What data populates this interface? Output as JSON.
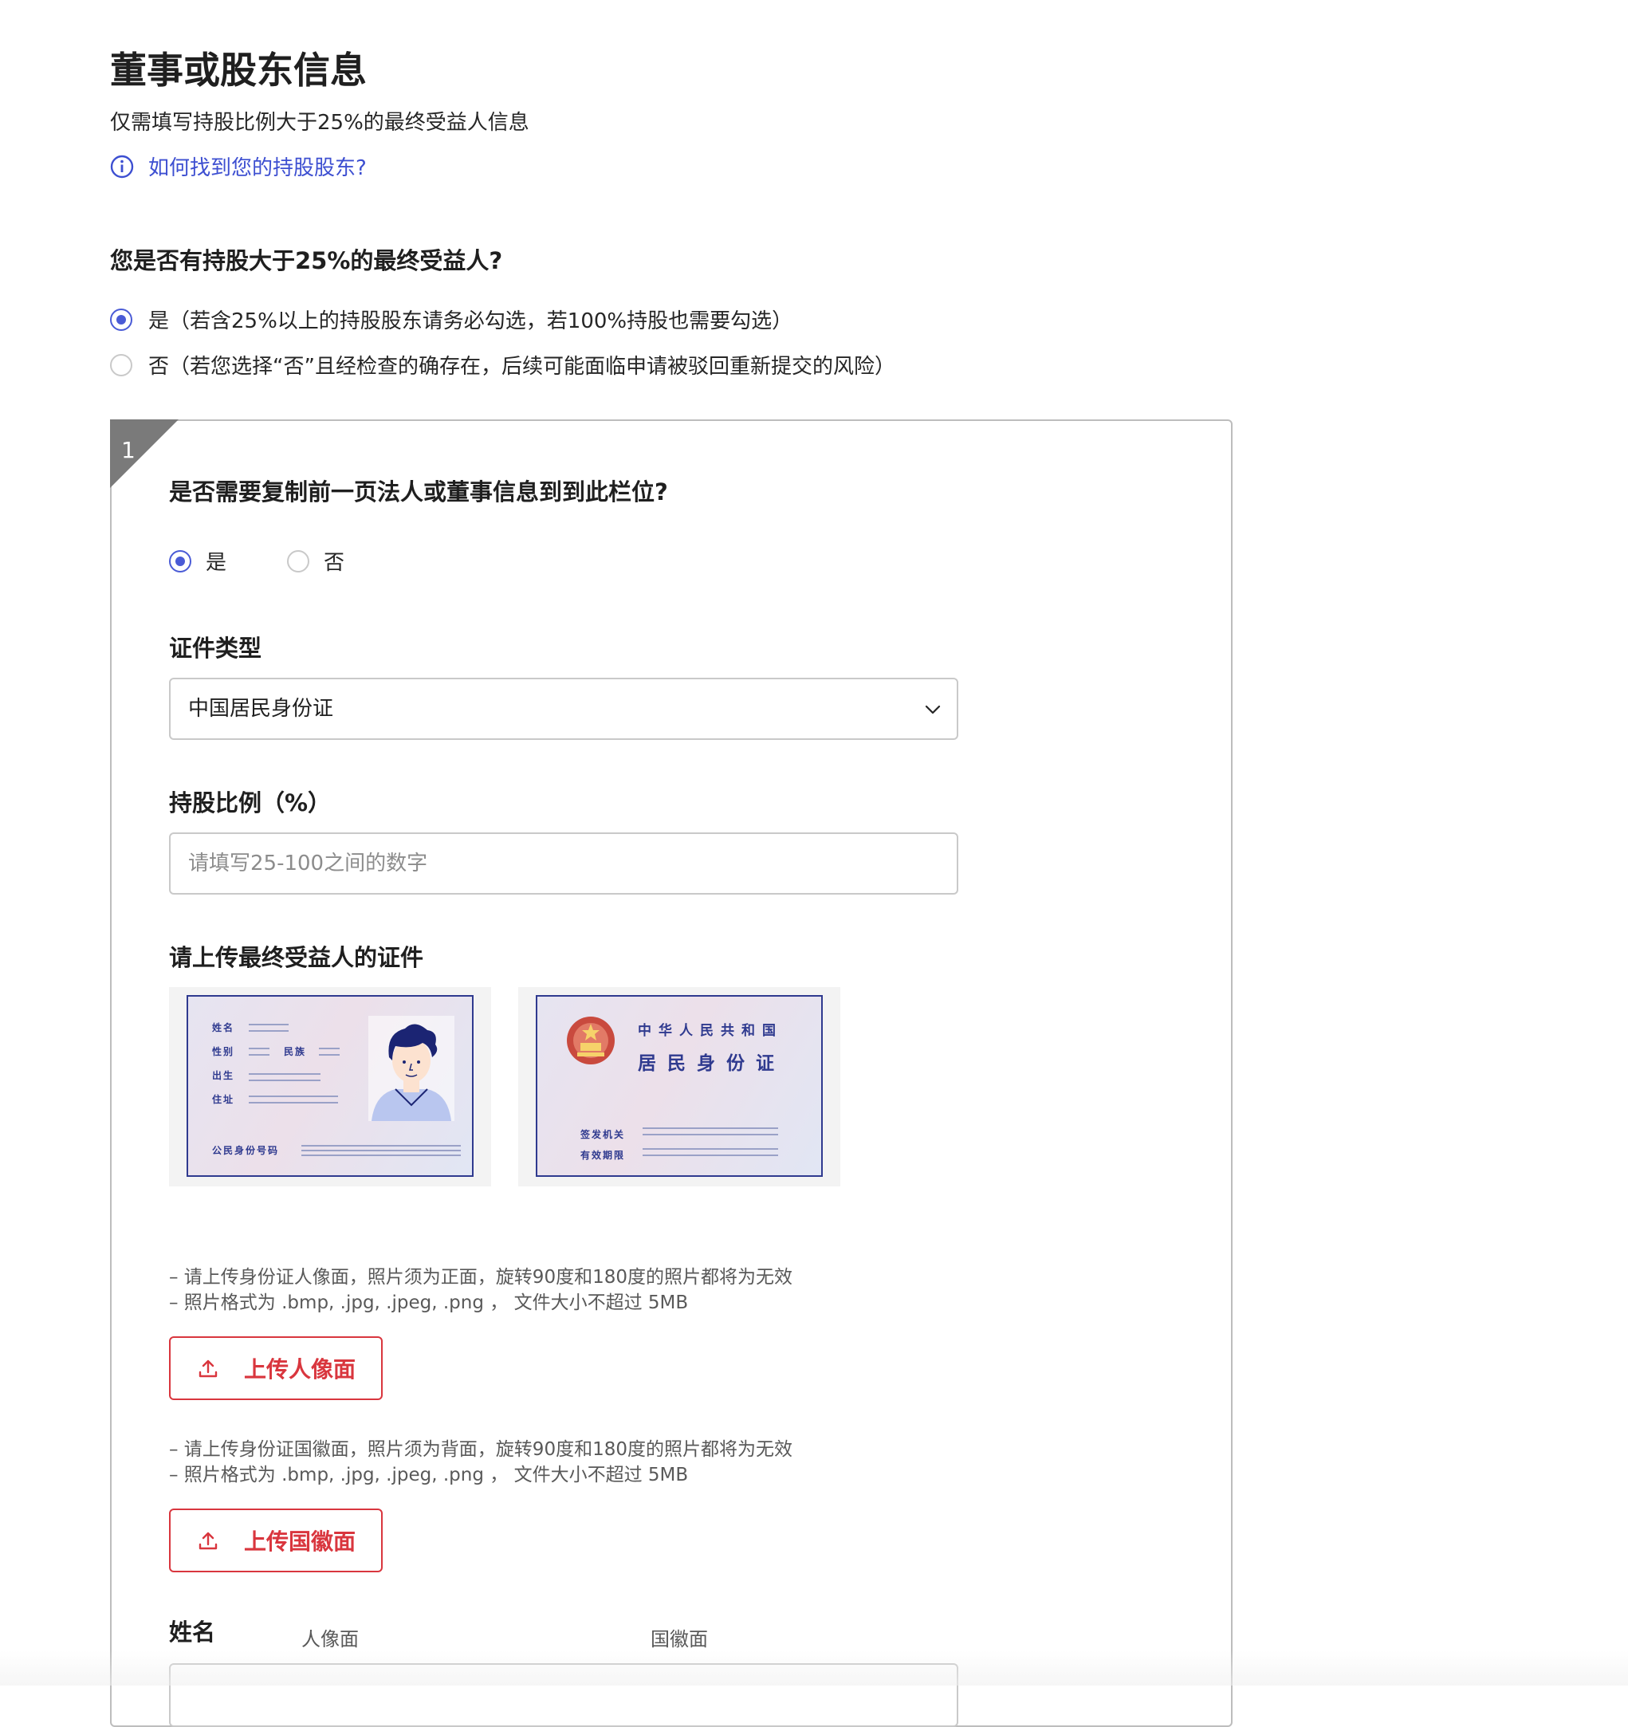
{
  "header": {
    "title": "董事或股东信息",
    "subtitle": "仅需填写持股比例大于25%的最终受益人信息",
    "help_link": "如何找到您的持股股东?"
  },
  "beneficiary_question": {
    "label": "您是否有持股大于25%的最终受益人?",
    "options": [
      {
        "label": "是（若含25%以上的持股股东请务必勾选，若100%持股也需要勾选）",
        "checked": true
      },
      {
        "label": "否（若您选择“否”且经检查的确存在，后续可能面临申请被驳回重新提交的风险）",
        "checked": false
      }
    ]
  },
  "card": {
    "index": "1",
    "copy_question": "是否需要复制前一页法人或董事信息到到此栏位?",
    "copy_options": [
      {
        "label": "是",
        "checked": true
      },
      {
        "label": "否",
        "checked": false
      }
    ],
    "id_type": {
      "label": "证件类型",
      "value": "中国居民身份证"
    },
    "share_ratio": {
      "label": "持股比例（%）",
      "placeholder": "请填写25-100之间的数字"
    },
    "upload": {
      "label": "请上传最终受益人的证件",
      "front_card": {
        "caption": "人像面",
        "fields": [
          "姓名",
          "性别",
          "民族",
          "出生",
          "住址",
          "公民身份号码"
        ]
      },
      "back_card": {
        "caption": "国徽面",
        "title1": "中华人民共和国",
        "title2": "居民身份证",
        "fields": [
          "签发机关",
          "有效期限"
        ]
      },
      "front_hints": [
        "– 请上传身份证人像面，照片须为正面，旋转90度和180度的照片都将为无效",
        "– 照片格式为 .bmp, .jpg, .jpeg, .png ， 文件大小不超过 5MB"
      ],
      "front_button": "上传人像面",
      "back_hints": [
        "– 请上传身份证国徽面，照片须为背面，旋转90度和180度的照片都将为无效",
        "– 照片格式为 .bmp, .jpg, .jpeg, .png ， 文件大小不超过 5MB"
      ],
      "back_button": "上传国徽面"
    },
    "name": {
      "label": "姓名"
    }
  },
  "icons": {
    "info": "info-icon",
    "chevron": "chevron-down-icon",
    "upload": "upload-icon"
  },
  "colors": {
    "accent": "#4a5bd6",
    "link": "#3d4fd1",
    "danger": "#d9363e",
    "card_border": "#2f3a8f",
    "corner": "#7a7a7a"
  }
}
